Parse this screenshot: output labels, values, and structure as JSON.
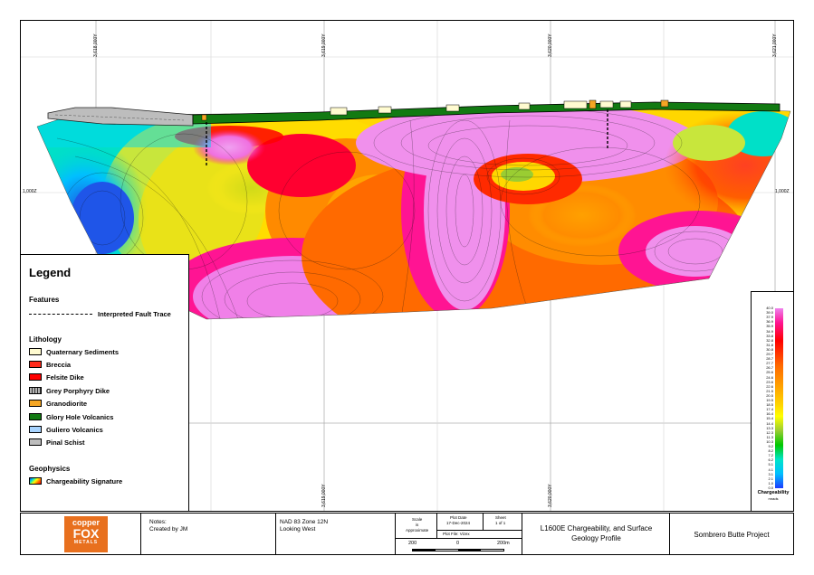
{
  "map": {
    "easting_top": [
      "3,618,000Y",
      "3,619,000Y",
      "3,620,000Y",
      "3,621,000Y"
    ],
    "easting_bottom": [
      "3,619,000Y",
      "3,620,000Y"
    ],
    "elevation_left": "1,000Z",
    "elevation_right": "1,000Z"
  },
  "legend": {
    "title": "Legend",
    "features_heading": "Features",
    "fault_label": "Interpreted Fault Trace",
    "lithology_heading": "Lithology",
    "lithology": [
      {
        "label": "Quaternary Sediments",
        "color": "#fffbd0"
      },
      {
        "label": "Breccia",
        "color": "#ff2a1a"
      },
      {
        "label": "Felsite Dike",
        "color": "#ff0000"
      },
      {
        "label": "Grey Porphyry Dike",
        "color": "#b4b4b4"
      },
      {
        "label": "Granodiorite",
        "color": "#f5a623"
      },
      {
        "label": "Glory Hole Volcanics",
        "color": "#127a12"
      },
      {
        "label": "Guliero Volcanics",
        "color": "#a8d4ff"
      },
      {
        "label": "Pinal Schist",
        "color": "#bdbdbd"
      }
    ],
    "geophysics_heading": "Geophysics",
    "geophysics_label": "Chargeability Signature"
  },
  "colorbar": {
    "ticks": [
      "40.0",
      "39.0",
      "37.9",
      "36.9",
      "35.9",
      "34.9",
      "33.8",
      "32.8",
      "31.8",
      "30.8",
      "29.7",
      "28.7",
      "27.7",
      "26.7",
      "25.6",
      "24.6",
      "23.6",
      "22.6",
      "21.5",
      "20.5",
      "19.5",
      "18.5",
      "17.4",
      "16.4",
      "15.4",
      "14.4",
      "13.3",
      "12.3",
      "11.3",
      "10.3",
      "9.2",
      "8.2",
      "7.2",
      "6.2",
      "5.1",
      "4.1",
      "3.1",
      "2.1",
      "1.0",
      "0.0"
    ],
    "title": "Chargeability",
    "units": "mrads",
    "min": 0.0,
    "max": 40.0
  },
  "title_block": {
    "logo_line1": "copper",
    "logo_line2": "FOX",
    "logo_line3": "METALS",
    "notes_label": "Notes:",
    "notes_value": "Created by JM",
    "datum": "NAD 83 Zone 12N",
    "view": "Looking West",
    "scale_label": "Scale",
    "scale_is": "is",
    "scale_value": "Approximate",
    "plot_date_label": "Plot Date",
    "plot_date": "17-Dec-2024",
    "sheet_label": "Sheet",
    "sheet_value": "1 of 1",
    "plot_file": "Plot File: Vizex",
    "scale_ticks": [
      "200",
      "0",
      "200m"
    ],
    "title_line1": "L1600E Chargeability, and Surface",
    "title_line2": "Geology Profile",
    "project": "Sombrero Butte Project"
  }
}
